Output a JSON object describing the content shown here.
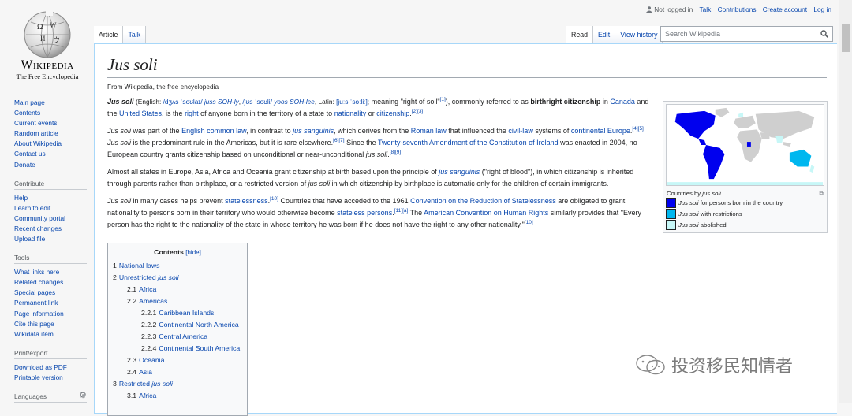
{
  "logo": {
    "wordmark": "Wikipedia",
    "tagline": "The Free Encyclopedia"
  },
  "personal": [
    "Not logged in",
    "Talk",
    "Contributions",
    "Create account",
    "Log in"
  ],
  "tabs_left": [
    "Article",
    "Talk"
  ],
  "tabs_right": [
    "Read",
    "Edit",
    "View history"
  ],
  "search_placeholder": "Search Wikipedia",
  "nav_main": [
    "Main page",
    "Contents",
    "Current events",
    "Random article",
    "About Wikipedia",
    "Contact us",
    "Donate"
  ],
  "contribute": {
    "heading": "Contribute",
    "items": [
      "Help",
      "Learn to edit",
      "Community portal",
      "Recent changes",
      "Upload file"
    ]
  },
  "tools": {
    "heading": "Tools",
    "items": [
      "What links here",
      "Related changes",
      "Special pages",
      "Permanent link",
      "Page information",
      "Cite this page",
      "Wikidata item"
    ]
  },
  "printexport": {
    "heading": "Print/export",
    "items": [
      "Download as PDF",
      "Printable version"
    ]
  },
  "languages": {
    "heading": "Languages"
  },
  "article": {
    "title": "Jus soli",
    "site_sub": "From Wikipedia, the free encyclopedia"
  },
  "infobox": {
    "caption": "Countries by jus soli",
    "legend": [
      {
        "label": "Jus soli for persons born in the country",
        "color": "#0000ee"
      },
      {
        "label": "Jus soli with restrictions",
        "color": "#00b7ef"
      },
      {
        "label": "Jus soli abolished",
        "color": "#c7f7f7"
      }
    ]
  },
  "toc": {
    "title": "Contents",
    "hide": "[hide]",
    "items": [
      {
        "num": "1",
        "text": "National laws",
        "lvl": 1
      },
      {
        "num": "2",
        "text": "Unrestricted jus soli",
        "lvl": 1
      },
      {
        "num": "2.1",
        "text": "Africa",
        "lvl": 2
      },
      {
        "num": "2.2",
        "text": "Americas",
        "lvl": 2
      },
      {
        "num": "2.2.1",
        "text": "Caribbean Islands",
        "lvl": 3
      },
      {
        "num": "2.2.2",
        "text": "Continental North America",
        "lvl": 3
      },
      {
        "num": "2.2.3",
        "text": "Central America",
        "lvl": 3
      },
      {
        "num": "2.2.4",
        "text": "Continental South America",
        "lvl": 3
      },
      {
        "num": "2.3",
        "text": "Oceania",
        "lvl": 2
      },
      {
        "num": "2.4",
        "text": "Asia",
        "lvl": 2
      },
      {
        "num": "3",
        "text": "Restricted jus soli",
        "lvl": 1
      },
      {
        "num": "3.1",
        "text": "Africa",
        "lvl": 2
      }
    ]
  },
  "watermark": "投资移民知情者"
}
